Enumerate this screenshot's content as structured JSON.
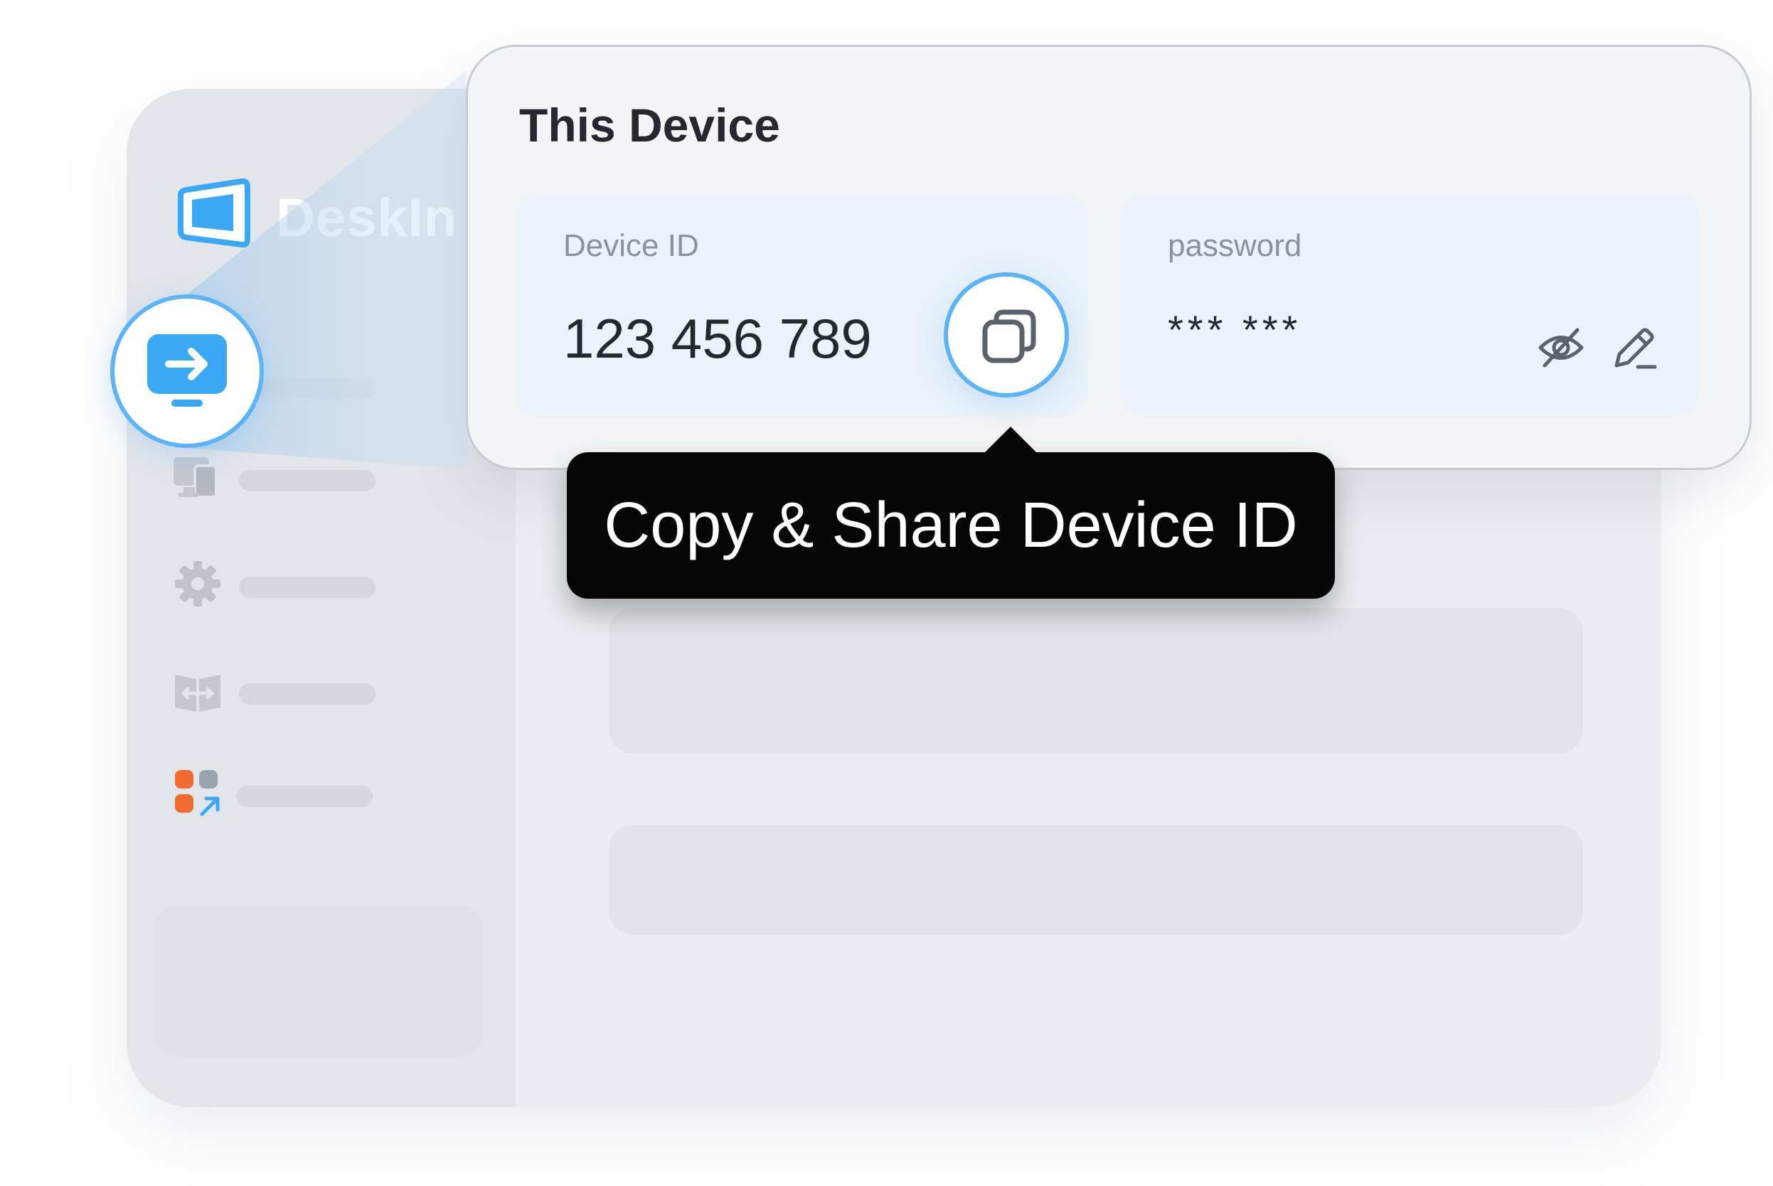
{
  "app": {
    "name": "DeskIn"
  },
  "panel": {
    "title": "This Device",
    "device_id": {
      "label": "Device ID",
      "value": "123 456 789"
    },
    "password": {
      "label": "password",
      "value": "*** ***"
    }
  },
  "tooltip": {
    "text": "Copy & Share Device ID"
  },
  "icons": {
    "brand": "deskin-logo",
    "active_nav": "remote-connect-icon",
    "devices": "devices-icon",
    "settings": "gear-icon",
    "transfer": "file-transfer-icon",
    "apps": "apps-icon",
    "copy": "copy-icon",
    "visibility": "eye-off-icon",
    "edit": "pencil-icon"
  },
  "colors": {
    "accent": "#5cb3f7",
    "brand_blue": "#3ca7f5",
    "tooltip_bg": "#060606",
    "apps_orange": "#f26a2d"
  }
}
